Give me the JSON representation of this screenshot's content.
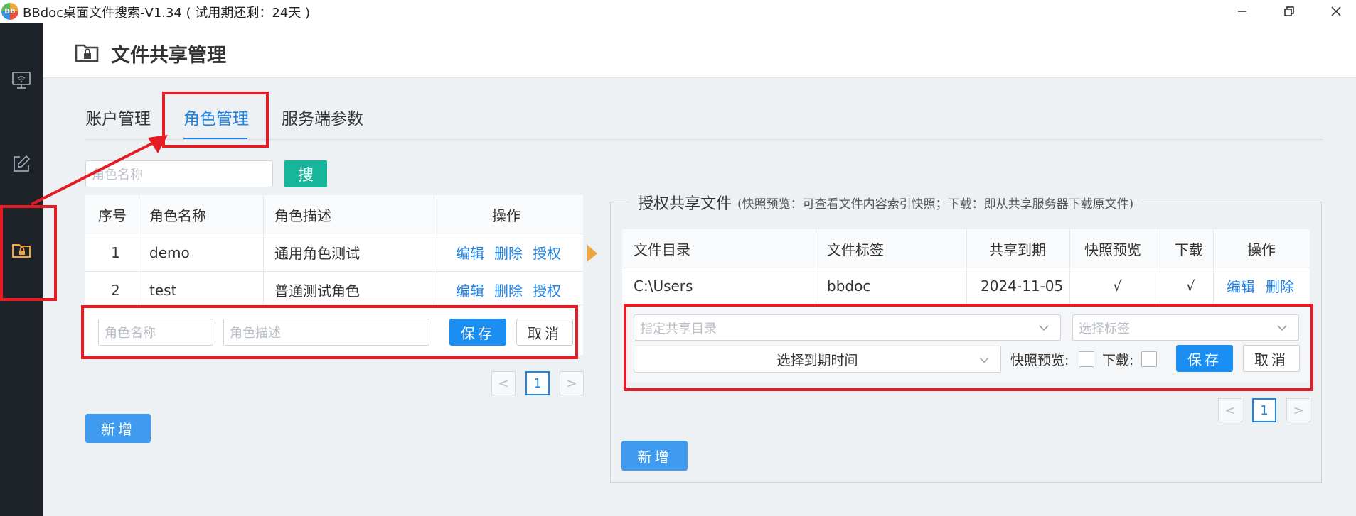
{
  "window": {
    "title": "BBdoc桌面文件搜索-V1.34 ( 试用期还剩：24天 )",
    "logo_text": "BB"
  },
  "header": {
    "title": "文件共享管理"
  },
  "tabs": [
    {
      "label": "账户管理"
    },
    {
      "label": "角色管理",
      "active": true
    },
    {
      "label": "服务端参数"
    }
  ],
  "role_search": {
    "placeholder": "角色名称",
    "button": "搜"
  },
  "role_table": {
    "columns": [
      "序号",
      "角色名称",
      "角色描述",
      "操作"
    ],
    "rows": [
      {
        "index": "1",
        "name": "demo",
        "desc": "通用角色测试",
        "actions": [
          "编辑",
          "删除",
          "授权"
        ]
      },
      {
        "index": "2",
        "name": "test",
        "desc": "普通测试角色",
        "actions": [
          "编辑",
          "删除",
          "授权"
        ]
      }
    ]
  },
  "role_edit": {
    "name_placeholder": "角色名称",
    "desc_placeholder": "角色描述",
    "save": "保存",
    "cancel": "取消"
  },
  "role_pager": {
    "prev": "<",
    "current": "1",
    "next": ">"
  },
  "role_add": "新增",
  "share": {
    "title": "授权共享文件",
    "note": "(快照预览：可查看文件内容索引快照；下载：即从共享服务器下载原文件)",
    "columns": [
      "文件目录",
      "文件标签",
      "共享到期",
      "快照预览",
      "下载",
      "操作"
    ],
    "rows": [
      {
        "dir": "C:\\Users",
        "tag": "bbdoc",
        "expire": "2024-11-05",
        "preview": "√",
        "download": "√",
        "actions": [
          "编辑",
          "删除"
        ]
      }
    ],
    "edit": {
      "dir_placeholder": "指定共享目录",
      "tag_placeholder": "选择标签",
      "expire_value": "选择到期时间",
      "preview_label": "快照预览:",
      "download_label": "下载:",
      "save": "保存",
      "cancel": "取消"
    },
    "pager": {
      "prev": "<",
      "current": "1",
      "next": ">"
    },
    "add": "新增"
  },
  "colors": {
    "accent": "#1a8ef2",
    "teal": "#17b59a",
    "annotation": "#e51c23",
    "sidebar": "#1e2229"
  }
}
